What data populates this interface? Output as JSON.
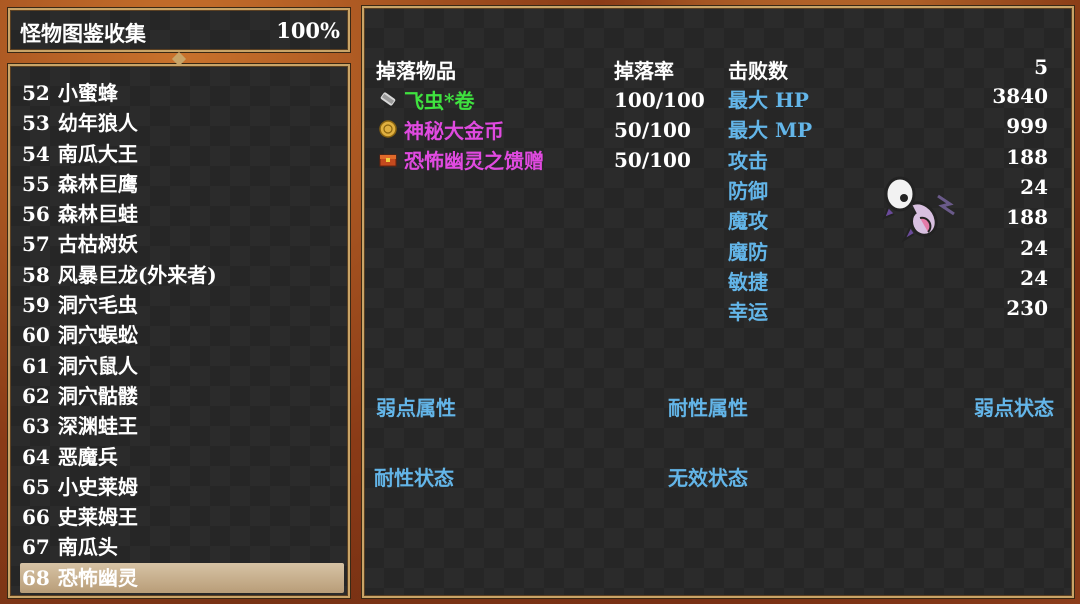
{
  "title": {
    "label": "怪物图鉴收集",
    "percent": "100%"
  },
  "monsters": [
    {
      "num": "52",
      "name": "小蜜蜂"
    },
    {
      "num": "53",
      "name": "幼年狼人"
    },
    {
      "num": "54",
      "name": "南瓜大王"
    },
    {
      "num": "55",
      "name": "森林巨鹰"
    },
    {
      "num": "56",
      "name": "森林巨蛙"
    },
    {
      "num": "57",
      "name": "古枯树妖"
    },
    {
      "num": "58",
      "name": "风暴巨龙(外来者)"
    },
    {
      "num": "59",
      "name": "洞穴毛虫"
    },
    {
      "num": "60",
      "name": "洞穴蜈蚣"
    },
    {
      "num": "61",
      "name": "洞穴鼠人"
    },
    {
      "num": "62",
      "name": "洞穴骷髅"
    },
    {
      "num": "63",
      "name": "深渊蛙王"
    },
    {
      "num": "64",
      "name": "恶魔兵"
    },
    {
      "num": "65",
      "name": "小史莱姆"
    },
    {
      "num": "66",
      "name": "史莱姆王"
    },
    {
      "num": "67",
      "name": "南瓜头"
    },
    {
      "num": "68",
      "name": "恐怖幽灵"
    }
  ],
  "selected_index": 16,
  "headers": {
    "drops": "掉落物品",
    "rate": "掉落率",
    "kills": "击败数",
    "kills_value": "5"
  },
  "drops": [
    {
      "name": "飞虫*卷",
      "rate": "100/100",
      "color": "#3fe23f",
      "icon": "scroll-icon"
    },
    {
      "name": "神秘大金币",
      "rate": "50/100",
      "color": "#e04ae0",
      "icon": "coin-icon"
    },
    {
      "name": "恐怖幽灵之馈赠",
      "rate": "50/100",
      "color": "#e04ae0",
      "icon": "chest-icon"
    }
  ],
  "stats": [
    {
      "label": "最大 HP",
      "value": "3840"
    },
    {
      "label": "最大 MP",
      "value": "999"
    },
    {
      "label": "攻击",
      "value": "188"
    },
    {
      "label": "防御",
      "value": "24"
    },
    {
      "label": "魔攻",
      "value": "188"
    },
    {
      "label": "魔防",
      "value": "24"
    },
    {
      "label": "敏捷",
      "value": "24"
    },
    {
      "label": "幸运",
      "value": "230"
    }
  ],
  "sections": {
    "weak_attr": "弱点属性",
    "resist_attr": "耐性属性",
    "weak_state": "弱点状态",
    "resist_state": "耐性状态",
    "immune_state": "无效状态"
  },
  "colors": {
    "stat_label": "#63b5e8",
    "frame": "#c9a467",
    "window_bg": "#2b2b2b"
  }
}
